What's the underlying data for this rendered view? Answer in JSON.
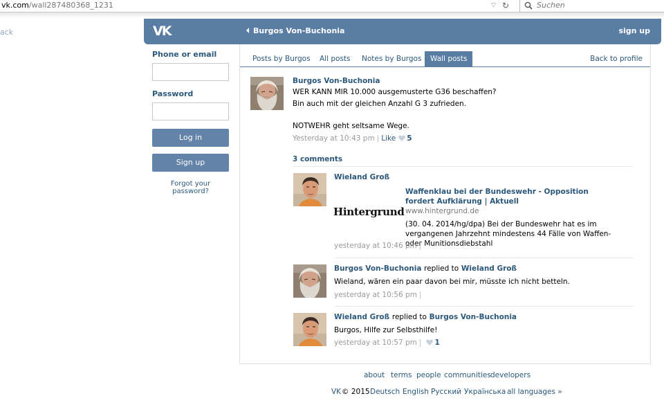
{
  "browser": {
    "url_host": "vk.com",
    "url_path": "/wall287480368_1231",
    "search_placeholder": "Suchen"
  },
  "sidebar_back": "ack",
  "header": {
    "logo": "VK",
    "back_label": "Burgos Von-Buchonia",
    "signup": "sign up"
  },
  "login": {
    "phone_label": "Phone or email",
    "password_label": "Password",
    "login_button": "Log in",
    "signup_button": "Sign up",
    "forgot": "Forgot your password?"
  },
  "tabs": [
    {
      "label": "Posts by Burgos",
      "active": false
    },
    {
      "label": "All posts",
      "active": false
    },
    {
      "label": "Notes by Burgos",
      "active": false
    },
    {
      "label": "Wall posts",
      "active": true
    }
  ],
  "back_to_profile": "Back to profile",
  "post": {
    "author": "Burgos Von-Buchonia",
    "lines": [
      "WER KANN MIR 10.000 ausgemusterte G36 beschaffen?",
      "Bin auch mit der gleichen Anzahl G 3 zufrieden.",
      "",
      "NOTWEHR geht seltsame Wege."
    ],
    "time": "Yesterday at 10:43 pm",
    "sep": "|",
    "like_label": "Like",
    "likes": "5"
  },
  "comments_count": "3 comments",
  "comments": [
    {
      "author": "Wieland Groß",
      "link_logo": "Hintergrund",
      "link_title": "Waffenklau bei der Bundeswehr - Opposition fordert Aufklärung | Aktuell",
      "link_domain": "www.hintergrund.de",
      "link_desc": "(30. 04. 2014/hg/dpa) Bei der Bundeswehr hat es im vergangenen Jahrzehnt mindestens 44 Fälle von Waffen- oder Munitionsdiebstahl",
      "time": "yesterday at 10:46 pm",
      "sep": "|"
    },
    {
      "author": "Burgos Von-Buchonia",
      "replied_to_label": "replied to",
      "replied_to": "Wieland Groß",
      "text": "Wieland, wären ein paar davon bei mir, müsste ich nicht betteln.",
      "time": "yesterday at 10:56 pm",
      "sep": "|"
    },
    {
      "author": "Wieland Groß",
      "replied_to_label": "replied to",
      "replied_to": "Burgos Von-Buchonia",
      "text": "Burgos, Hilfe zur Selbsthilfe!",
      "time": "yesterday at 10:57 pm",
      "sep": "|",
      "likes": "1"
    }
  ],
  "footer": {
    "links": [
      "about",
      "terms",
      "people",
      "communities",
      "developers"
    ],
    "brand": "VK",
    "copyright": "© 2015",
    "languages": [
      "Deutsch",
      "English",
      "Русский",
      "Українська",
      "all languages »"
    ]
  },
  "colors": {
    "header_bg": "#597da3",
    "link": "#2b587a",
    "button": "#6383a8"
  }
}
